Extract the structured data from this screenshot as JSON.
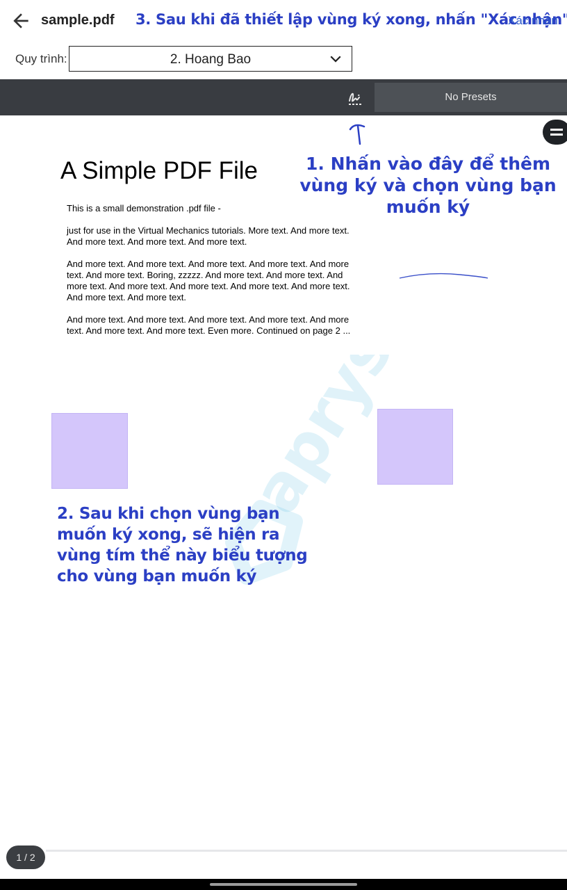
{
  "header": {
    "file_name": "sample.pdf",
    "step3_note": "3. Sau khi đã thiết lập vùng ký xong, nhấn \"Xác nhận\"",
    "confirm_label": "Xác nhận"
  },
  "workflow": {
    "label": "Quy trình:",
    "selected": "2. Hoang Bao"
  },
  "toolbar": {
    "presets_label": "No Presets"
  },
  "annotations": {
    "step1": "1. Nhấn vào đây để thêm vùng ký và chọn vùng bạn muốn ký",
    "step2": "2. Sau khi chọn vùng bạn muốn ký xong, sẽ hiện ra vùng tím thể này biểu tượng cho vùng bạn muốn ký"
  },
  "document": {
    "title": "A Simple PDF File",
    "paragraphs": [
      "This is a small demonstration .pdf file -",
      "just for use in the Virtual Mechanics tutorials. More text. And more text. And more text. And more text. And more text.",
      "And more text. And more text. And more text. And more text. And more text. And more text. Boring, zzzzz. And more text. And more text. And more text. And more text. And more text. And more text. And more text. And more text. And more text.",
      "And more text. And more text. And more text. And more text. And more text. And more text. And more text. Even more. Continued on page 2 ..."
    ],
    "watermark": "apryse"
  },
  "colors": {
    "annotation_blue": "#2b3fc4",
    "signature_field": "#d4c6fb",
    "toolbar": "#393c41"
  },
  "footer": {
    "page_indicator": "1 / 2"
  }
}
